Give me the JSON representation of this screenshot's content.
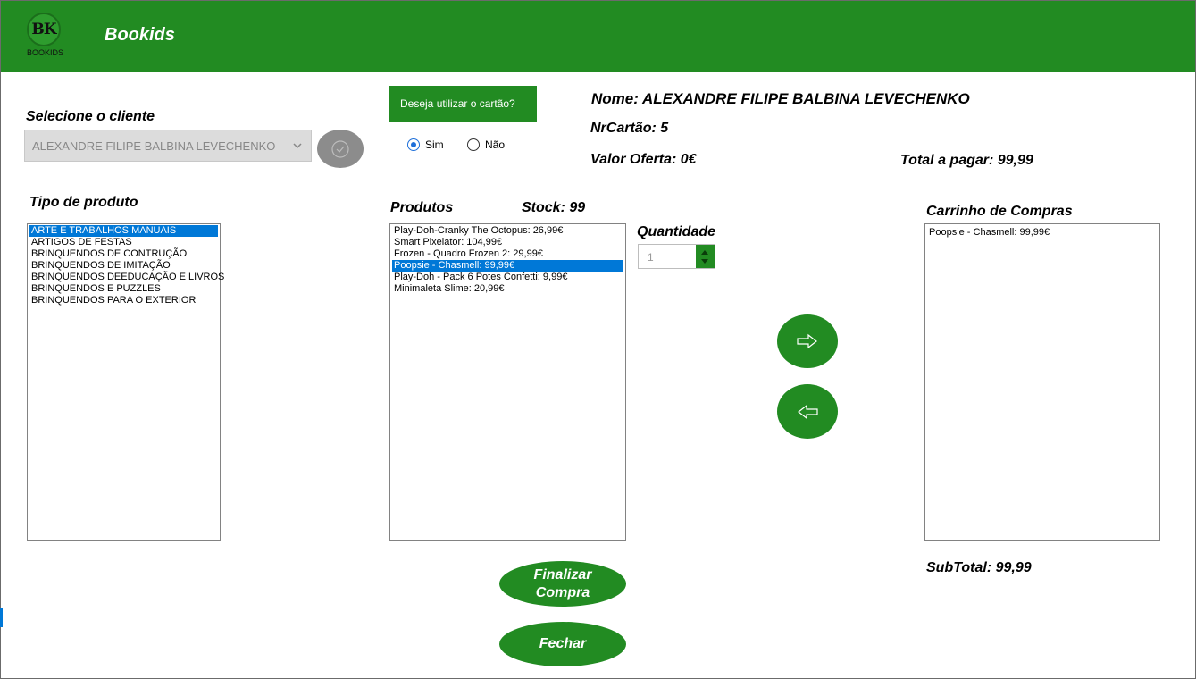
{
  "app": {
    "title": "Bookids",
    "logo_mark": "BK",
    "logo_sub": "BOOKIDS"
  },
  "client": {
    "label": "Selecione o cliente",
    "selected": "ALEXANDRE FILIPE BALBINA LEVECHENKO"
  },
  "card": {
    "question": "Deseja utilizar o cartão?",
    "option_yes": "Sim",
    "option_no": "Não",
    "selected": "Sim"
  },
  "info": {
    "name": "Nome: ALEXANDRE FILIPE BALBINA LEVECHENKO",
    "card_number": "NrCartão: 5",
    "offer_value": "Valor Oferta: 0€",
    "total": "Total a pagar: 99,99"
  },
  "product_types": {
    "label": "Tipo de produto",
    "items": [
      "ARTE E TRABALHOS MANUAIS",
      "ARTIGOS DE FESTAS",
      "BRINQUENDOS DE CONTRUÇÃO",
      "BRINQUENDOS DE IMITAÇÃO",
      "BRINQUENDOS DEEDUCAÇÃO E LIVROS",
      "BRINQUENDOS E PUZZLES",
      "BRINQUENDOS PARA O EXTERIOR"
    ],
    "selected_index": 0
  },
  "products": {
    "label": "Produtos",
    "stock": "Stock: 99",
    "items": [
      "Play-Doh-Cranky The Octopus: 26,99€",
      "Smart Pixelator: 104,99€",
      "Frozen - Quadro Frozen 2: 29,99€",
      "Poopsie - Chasmell: 99,99€",
      "Play-Doh - Pack 6 Potes Confetti: 9,99€",
      "Minimaleta Slime: 20,99€"
    ],
    "selected_index": 3
  },
  "quantity": {
    "label": "Quantidade",
    "value": "1"
  },
  "cart": {
    "label": "Carrinho de Compras",
    "items": [
      "Poopsie - Chasmell: 99,99€"
    ],
    "subtotal": "SubTotal:  99,99"
  },
  "actions": {
    "finalize_line1": "Finalizar",
    "finalize_line2": "Compra",
    "close": "Fechar",
    "add_icon": "arrow-right-icon",
    "remove_icon": "arrow-left-icon"
  },
  "colors": {
    "brand_green": "#228b22",
    "selection_blue": "#0078d7"
  }
}
